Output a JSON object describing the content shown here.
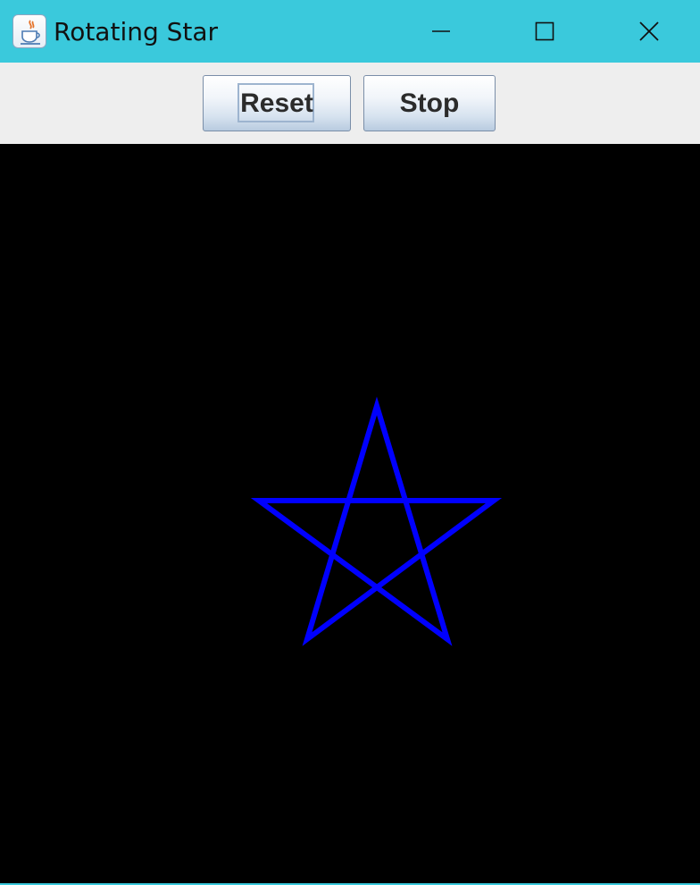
{
  "window": {
    "title": "Rotating Star",
    "titlebar_color": "#3ac9dc",
    "app_icon": "java-cup-icon"
  },
  "window_controls": {
    "minimize_icon": "minimize-icon",
    "maximize_icon": "maximize-icon",
    "close_icon": "close-icon"
  },
  "toolbar": {
    "reset_label": "Reset",
    "stop_label": "Stop"
  },
  "canvas": {
    "background": "#000000",
    "shape": "five-point-star",
    "stroke_color": "#0000ff"
  }
}
